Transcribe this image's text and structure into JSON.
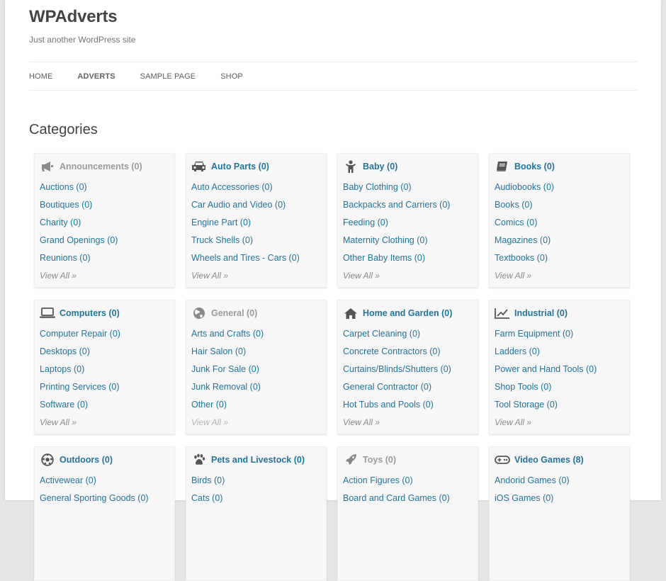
{
  "site": {
    "title": "WPAdverts",
    "description": "Just another WordPress site"
  },
  "nav": {
    "items": [
      "HOME",
      "ADVERTS",
      "SAMPLE PAGE",
      "SHOP"
    ],
    "active": "ADVERTS"
  },
  "page": {
    "heading": "Categories"
  },
  "colors": {
    "link": "#21759b",
    "muted_title": "#9a9a9a",
    "card_bg": "#f7f7f7"
  },
  "categories": [
    {
      "title": "Announcements (0)",
      "icon": "megaphone-icon",
      "muted": true,
      "items": [
        "Auctions (0)",
        "Boutiques (0)",
        "Charity (0)",
        "Grand Openings (0)",
        "Reunions (0)"
      ],
      "view_all": "View All »"
    },
    {
      "title": "Auto Parts (0)",
      "icon": "car-icon",
      "muted": false,
      "items": [
        "Auto Accessories (0)",
        "Car Audio and Video (0)",
        "Engine Part (0)",
        "Truck Shells (0)",
        "Wheels and Tires - Cars (0)"
      ],
      "view_all": "View All »"
    },
    {
      "title": "Baby (0)",
      "icon": "child-icon",
      "muted": false,
      "items": [
        "Baby Clothing (0)",
        "Backpacks and Carriers (0)",
        "Feeding (0)",
        "Maternity Clothing (0)",
        "Other Baby Items (0)"
      ],
      "view_all": "View All »"
    },
    {
      "title": "Books (0)",
      "icon": "book-icon",
      "muted": false,
      "items": [
        "Audiobooks (0)",
        "Books (0)",
        "Comics (0)",
        "Magazines (0)",
        "Textbooks (0)"
      ],
      "view_all": "View All »"
    },
    {
      "title": "Computers (0)",
      "icon": "laptop-icon",
      "muted": false,
      "items": [
        "Computer Repair (0)",
        "Desktops (0)",
        "Laptops (0)",
        "Printing Services (0)",
        "Software (0)"
      ],
      "view_all": "View All »"
    },
    {
      "title": "General (0)",
      "icon": "globe-icon",
      "muted": true,
      "items": [
        "Arts and Crafts (0)",
        "Hair Salon (0)",
        "Junk For Sale (0)",
        "Junk Removal (0)",
        "Other (0)"
      ],
      "view_all": "View All »"
    },
    {
      "title": "Home and Garden (0)",
      "icon": "home-icon",
      "muted": false,
      "items": [
        "Carpet Cleaning (0)",
        "Concrete Contractors (0)",
        "Curtains/Blinds/Shutters (0)",
        "General Contractor (0)",
        "Hot Tubs and Pools (0)"
      ],
      "view_all": "View All »"
    },
    {
      "title": "Industrial (0)",
      "icon": "line-chart-icon",
      "muted": false,
      "items": [
        "Farm Equipment (0)",
        "Ladders (0)",
        "Power and Hand Tools (0)",
        "Shop Tools (0)",
        "Tool Storage (0)"
      ],
      "view_all": "View All »"
    },
    {
      "title": "Outdoors (0)",
      "icon": "soccer-ball-icon",
      "muted": false,
      "items": [
        "Activewear (0)",
        "General Sporting Goods (0)"
      ],
      "view_all": ""
    },
    {
      "title": "Pets and Livestock (0)",
      "icon": "paw-icon",
      "muted": false,
      "items": [
        "Birds (0)",
        "Cats (0)"
      ],
      "view_all": ""
    },
    {
      "title": "Toys (0)",
      "icon": "rocket-icon",
      "muted": true,
      "items": [
        "Action Figures (0)",
        "Board and Card Games (0)"
      ],
      "view_all": ""
    },
    {
      "title": "Video Games (8)",
      "icon": "gamepad-icon",
      "muted": false,
      "items": [
        "Andorid Games (0)",
        "iOS Games (0)"
      ],
      "view_all": ""
    }
  ]
}
